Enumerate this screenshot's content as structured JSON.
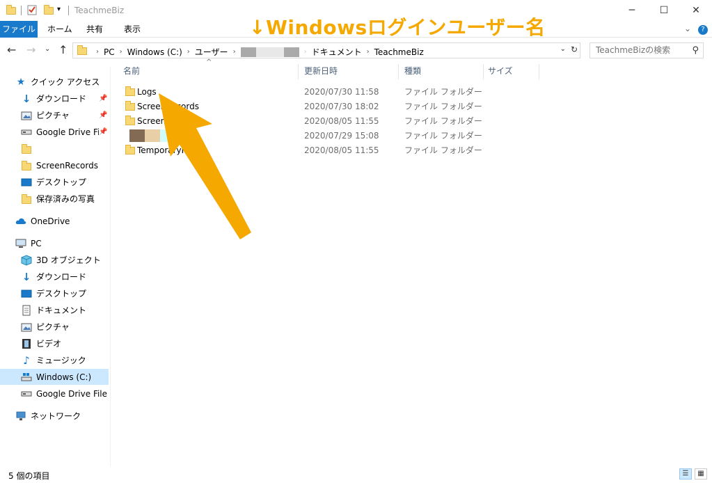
{
  "window": {
    "title": "TeachmeBiz",
    "minimize": "─",
    "maximize": "☐",
    "close": "✕"
  },
  "ribbon": {
    "tabs": [
      "ファイル",
      "ホーム",
      "共有",
      "表示"
    ]
  },
  "annotation": "↓Windowsログインユーザー名",
  "address": {
    "crumbs": [
      "PC",
      "Windows (C:)",
      "ユーザー",
      "ドキュメント",
      "TeachmeBiz"
    ]
  },
  "search": {
    "placeholder": "TeachmeBizの検索"
  },
  "sidebar": {
    "quick_access": "クイック アクセス",
    "quick_items": [
      "ダウンロード",
      "ピクチャ",
      "Google Drive File",
      "",
      "ScreenRecords",
      "デスクトップ",
      "保存済みの写真"
    ],
    "onedrive": "OneDrive",
    "pc": "PC",
    "pc_items": [
      "3D オブジェクト",
      "ダウンロード",
      "デスクトップ",
      "ドキュメント",
      "ピクチャ",
      "ビデオ",
      "ミュージック",
      "Windows (C:)",
      "Google Drive File St"
    ],
    "network": "ネットワーク"
  },
  "columns": {
    "name": "名前",
    "date": "更新日時",
    "type": "種類",
    "size": "サイズ"
  },
  "files": [
    {
      "name": "Logs",
      "date": "2020/07/30 11:58",
      "type": "ファイル フォルダー"
    },
    {
      "name": "ScreenRecords",
      "date": "2020/07/30 18:02",
      "type": "ファイル フォルダー"
    },
    {
      "name": "Screen",
      "date": "2020/08/05 11:55",
      "type": "ファイル フォルダー"
    },
    {
      "name": "",
      "date": "2020/07/29 15:08",
      "type": "ファイル フォルダー"
    },
    {
      "name": "TemporaryFiles",
      "date": "2020/08/05 11:55",
      "type": "ファイル フォルダー"
    }
  ],
  "status": "5 個の項目",
  "colors": {
    "accent": "#1979ca",
    "annotation": "#f5a800",
    "folder": "#f8d775",
    "selected": "#cce8ff"
  }
}
